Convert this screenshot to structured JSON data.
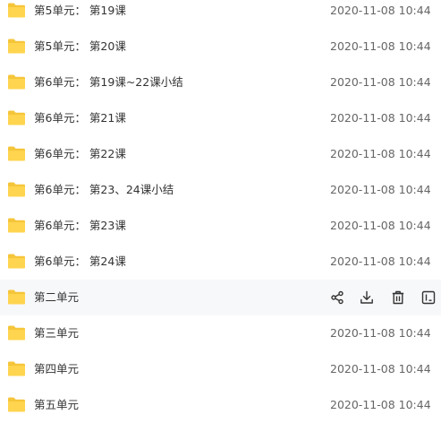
{
  "colors": {
    "folder": "#FFD44F",
    "folder_tab": "#F5C53A",
    "hover_row_bg": "#F7F8FA",
    "text": "#333333",
    "date_text": "#666666"
  },
  "files": [
    {
      "name": "第5单元： 第19课",
      "date": "2020-11-08 10:44",
      "icon": "folder-icon"
    },
    {
      "name": "第5单元： 第20课",
      "date": "2020-11-08 10:44",
      "icon": "folder-icon"
    },
    {
      "name": "第6单元： 第19课~22课小结",
      "date": "2020-11-08 10:44",
      "icon": "folder-icon"
    },
    {
      "name": "第6单元： 第21课",
      "date": "2020-11-08 10:44",
      "icon": "folder-icon"
    },
    {
      "name": "第6单元： 第22课",
      "date": "2020-11-08 10:44",
      "icon": "folder-icon"
    },
    {
      "name": "第6单元： 第23、24课小结",
      "date": "2020-11-08 10:44",
      "icon": "folder-icon"
    },
    {
      "name": "第6单元： 第23课",
      "date": "2020-11-08 10:44",
      "icon": "folder-icon"
    },
    {
      "name": "第6单元： 第24课",
      "date": "2020-11-08 10:44",
      "icon": "folder-icon"
    },
    {
      "name": "第二单元",
      "date": "",
      "icon": "folder-icon",
      "hovered": true,
      "actions": [
        "share-icon",
        "download-icon",
        "delete-icon",
        "rename-icon"
      ]
    },
    {
      "name": "第三单元",
      "date": "2020-11-08 10:44",
      "icon": "folder-icon"
    },
    {
      "name": "第四单元",
      "date": "2020-11-08 10:44",
      "icon": "folder-icon"
    },
    {
      "name": "第五单元",
      "date": "2020-11-08 10:44",
      "icon": "folder-icon"
    }
  ]
}
